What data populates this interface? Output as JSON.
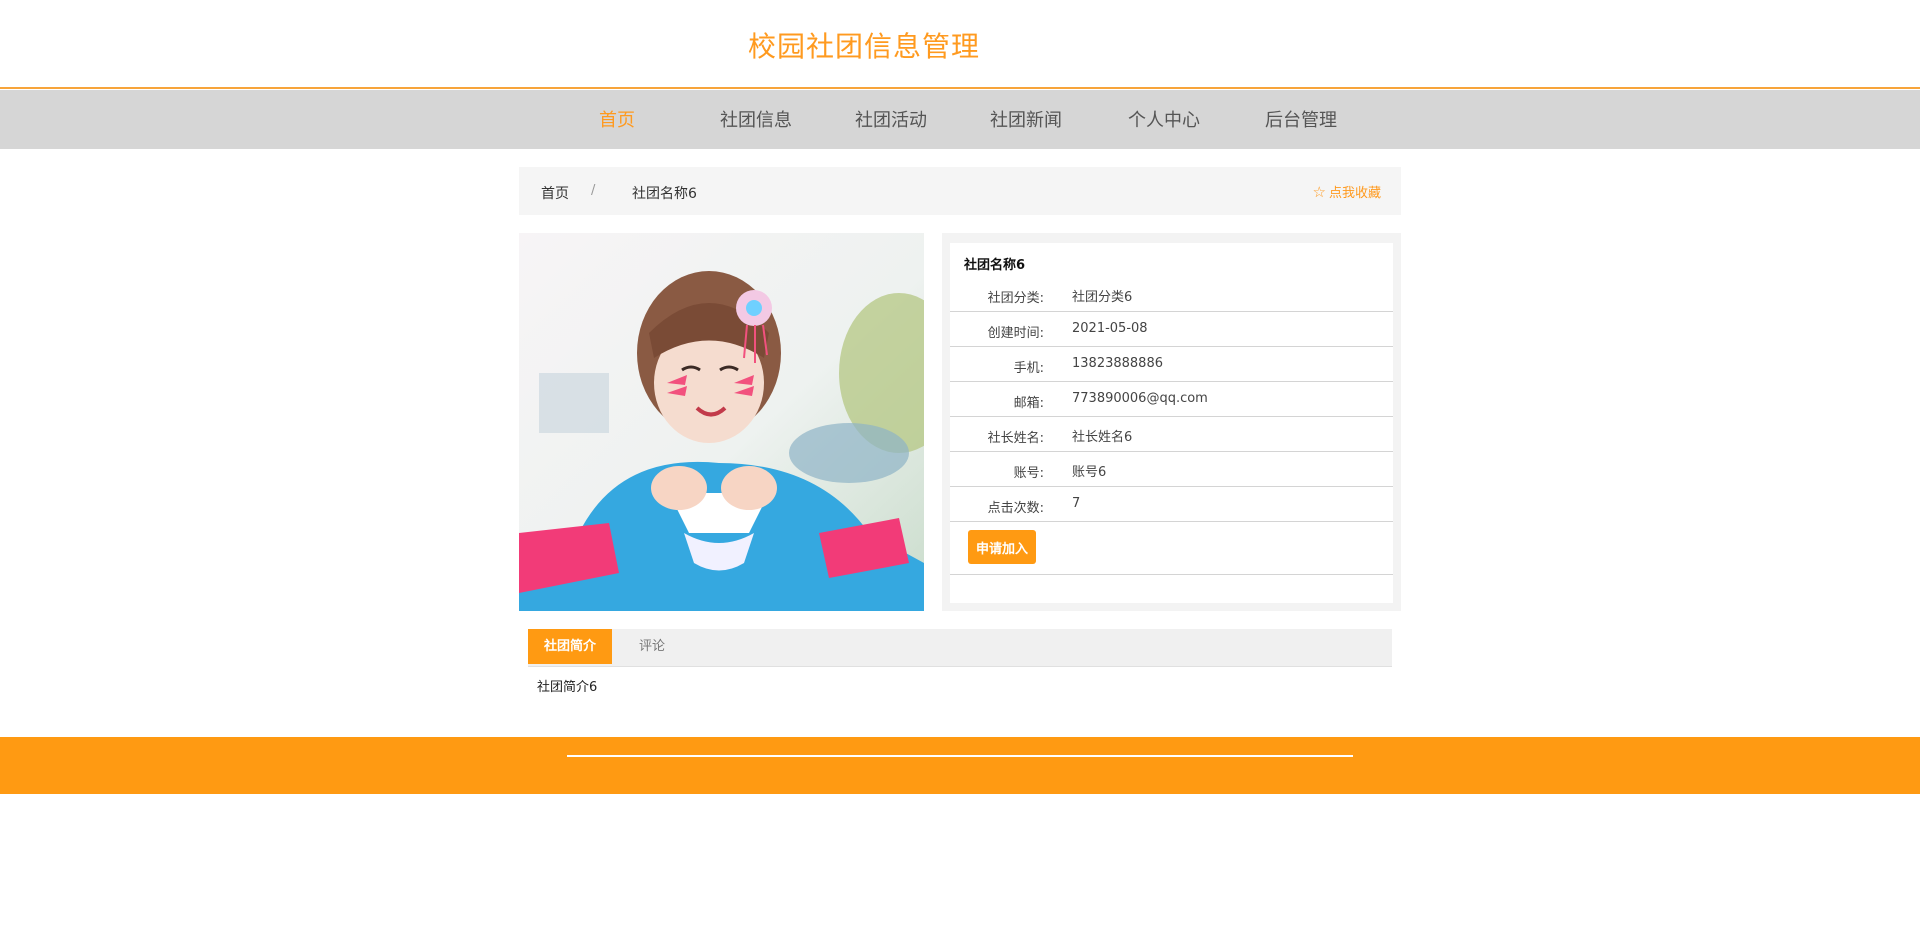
{
  "header": {
    "site_title": "校园社团信息管理"
  },
  "nav": {
    "items": [
      {
        "label": "首页",
        "active": true
      },
      {
        "label": "社团信息"
      },
      {
        "label": "社团活动"
      },
      {
        "label": "社团新闻"
      },
      {
        "label": "个人中心"
      },
      {
        "label": "后台管理"
      }
    ]
  },
  "breadcrumb": {
    "home": "首页",
    "separator": "/",
    "current": "社团名称6",
    "favorite_label": "点我收藏",
    "favorite_icon": "star-outline-icon"
  },
  "club": {
    "name": "社团名称6",
    "fields": [
      {
        "label": "社团分类:",
        "value": "社团分类6"
      },
      {
        "label": "创建时间:",
        "value": "2021-05-08"
      },
      {
        "label": "手机:",
        "value": "13823888886"
      },
      {
        "label": "邮箱:",
        "value": "773890006@qq.com"
      },
      {
        "label": "社长姓名:",
        "value": "社长姓名6"
      },
      {
        "label": "账号:",
        "value": "账号6"
      },
      {
        "label": "点击次数:",
        "value": "7"
      }
    ],
    "apply_label": "申请加入"
  },
  "tabs": {
    "items": [
      {
        "label": "社团简介",
        "active": true
      },
      {
        "label": "评论"
      }
    ],
    "content": "社团简介6"
  },
  "colors": {
    "accent": "#ff9a12",
    "nav_bg": "#d6d6d6",
    "header_border": "#f7a43a"
  }
}
